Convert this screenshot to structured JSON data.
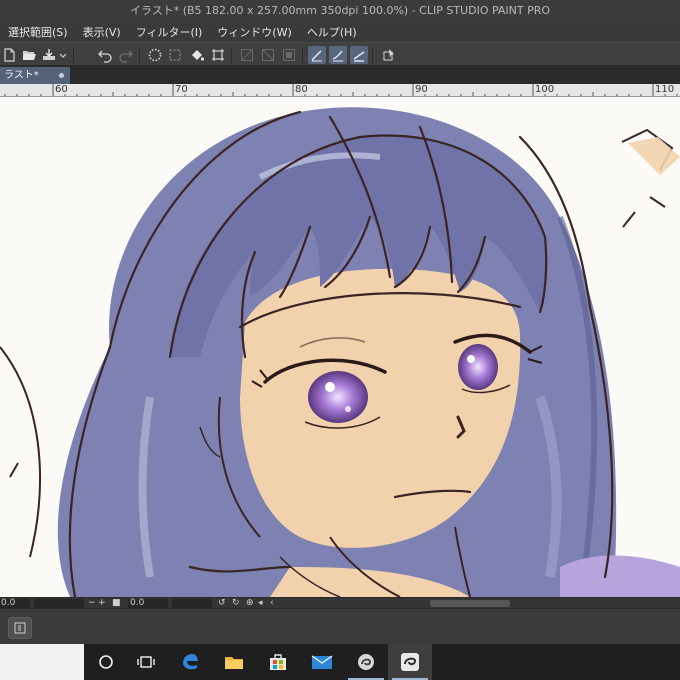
{
  "window": {
    "title": "イラスト* (B5 182.00 x 257.00mm 350dpi 100.0%)  - CLIP STUDIO PAINT PRO"
  },
  "menu": {
    "items": [
      "選択範囲(S)",
      "表示(V)",
      "フィルター(I)",
      "ウィンドウ(W)",
      "ヘルプ(H)"
    ]
  },
  "toolbar": {
    "icons": [
      "new-page-icon",
      "open-folder-icon",
      "save-icon",
      "dropdown-arrow-icon",
      "undo-icon",
      "redo-icon",
      "loading-spinner-icon",
      "fill-bucket-icon",
      "transform-icon",
      "ruler-snap-icon",
      "ruler-snap-2-icon",
      "ruler-snap-3-icon",
      "pen-stabilize-icon",
      "pen-stabilize-2-icon",
      "pen-stabilize-3-icon",
      "help-cursor-icon"
    ],
    "active": [
      "pen-stabilize-icon",
      "pen-stabilize-2-icon",
      "pen-stabilize-3-icon"
    ]
  },
  "tabs": {
    "document_label": "ラスト*"
  },
  "ruler": {
    "labels": [
      "60",
      "70",
      "80",
      "90",
      "100",
      "110"
    ]
  },
  "status": {
    "left_value": "0.0",
    "rotation_value": "0.0"
  },
  "colors": {
    "hair": "#7d82b2",
    "skin": "#f2d2ac",
    "line": "#3a2424",
    "eye": "#a77bd6",
    "accent": "#58677e"
  }
}
